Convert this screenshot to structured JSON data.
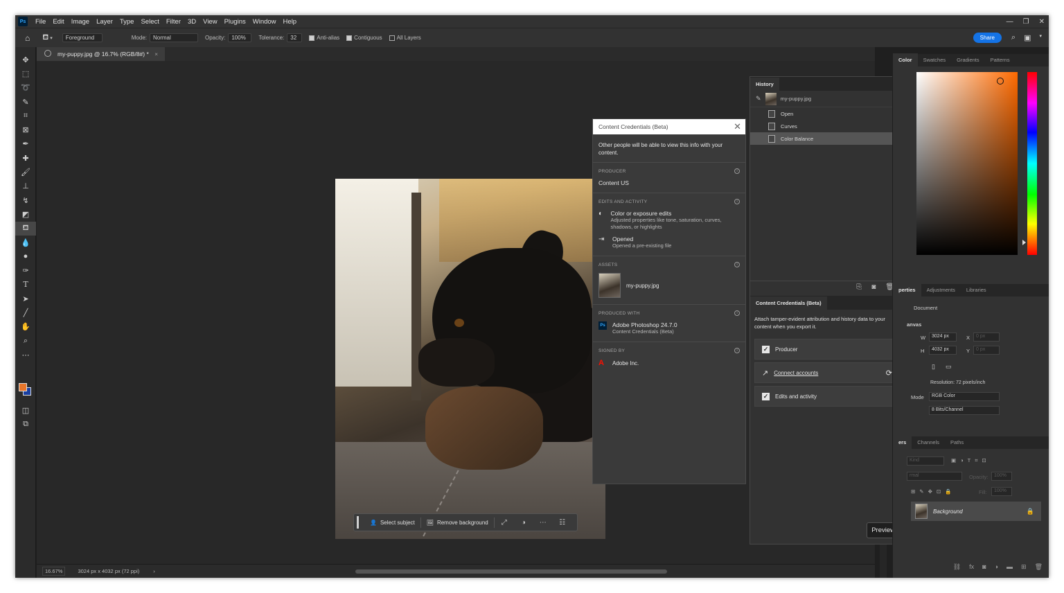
{
  "menu": {
    "items": [
      "File",
      "Edit",
      "Image",
      "Layer",
      "Type",
      "Select",
      "Filter",
      "3D",
      "View",
      "Plugins",
      "Window",
      "Help"
    ],
    "logo": "Ps"
  },
  "options": {
    "preset": "Foreground",
    "mode_label": "Mode:",
    "mode_value": "Normal",
    "opacity_label": "Opacity:",
    "opacity_value": "100%",
    "tolerance_label": "Tolerance:",
    "tolerance_value": "32",
    "antialias": "Anti-alias",
    "contiguous": "Contiguous",
    "all_layers": "All Layers",
    "share": "Share"
  },
  "document": {
    "tab_title": "my-puppy.jpg @ 16.7% (RGB/8#) *",
    "zoom": "16.67%",
    "dimensions": "3024 px x 4032 px (72 ppi)"
  },
  "context_bar": {
    "select_subject": "Select subject",
    "remove_background": "Remove background"
  },
  "content_credentials_panel": {
    "title": "Content Credentials (Beta)",
    "intro": "Other people will be able to view this info with your content.",
    "producer_title": "PRODUCER",
    "producer_value": "Content US",
    "edits_title": "EDITS AND ACTIVITY",
    "edits": [
      {
        "title": "Color or exposure edits",
        "desc": "Adjusted properties like tone, saturation, curves, shadows, or highlights"
      },
      {
        "title": "Opened",
        "desc": "Opened a pre-existing file"
      }
    ],
    "assets_title": "ASSETS",
    "asset_name": "my-puppy.jpg",
    "produced_with_title": "PRODUCED WITH",
    "produced_with_app": "Adobe Photoshop 24.7.0",
    "produced_with_sub": "Content Credentials (Beta)",
    "signed_by_title": "SIGNED BY",
    "signed_by_value": "Adobe Inc."
  },
  "history": {
    "tab": "History",
    "snapshot": "my-puppy.jpg",
    "items": [
      "Open",
      "Curves",
      "Color Balance"
    ]
  },
  "cc_docked": {
    "tab": "Content Credentials (Beta)",
    "desc": "Attach tamper-evident attribution and history data to your content when you export it.",
    "producer": "Producer",
    "connect": "Connect accounts",
    "edits": "Edits and activity",
    "preview": "Preview"
  },
  "right_panels": {
    "color_tabs": [
      "Color",
      "Swatches",
      "Gradients",
      "Patterns"
    ],
    "prop_tabs": [
      "perties",
      "Adjustments",
      "Libraries"
    ],
    "document_label": "Document",
    "canvas_label": "anvas",
    "w_label": "W",
    "w_value": "3024 px",
    "h_label": "H",
    "h_value": "4032 px",
    "x_label": "X",
    "x_value": "0 px",
    "y_label": "Y",
    "y_value": "0 px",
    "resolution": "Resolution: 72 pixels/inch",
    "mode_label": "Mode",
    "mode_value": "RGB Color",
    "bits_value": "8 Bits/Channel",
    "layer_tabs": [
      "ers",
      "Channels",
      "Paths"
    ],
    "kind": "Kind",
    "blend": "rmal",
    "opacity": "Opacity:",
    "opacity_value": "100%",
    "fill": "Fill:",
    "fill_value": "100%",
    "layer_name": "Background"
  },
  "colors": {
    "foreground": "#e8762b",
    "background": "#1a3fa0",
    "accent": "#1473e6"
  }
}
